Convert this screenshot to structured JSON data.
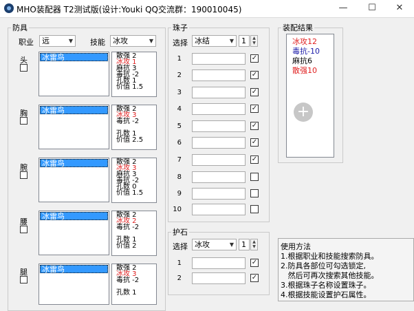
{
  "window": {
    "title": "MHO装配器 T2测试版(设计:Youki QQ交流群：190010045)",
    "minimize": "—",
    "maximize": "☐",
    "close": "✕"
  },
  "armor": {
    "group_label": "防具",
    "job_label": "职业",
    "job_value": "远",
    "skill_label": "技能",
    "skill_value": "冰攻",
    "slots": [
      {
        "name": "头",
        "item": "冰雷鸟",
        "stats": [
          {
            "t": "散强 2",
            "c": "normal"
          },
          {
            "t": "冰攻 1",
            "c": "red"
          },
          {
            "t": "麻抗 3",
            "c": "normal"
          },
          {
            "t": "毒抗 -2",
            "c": "normal"
          },
          {
            "t": "孔数 1",
            "c": "normal"
          },
          {
            "t": "价值 1.5",
            "c": "normal"
          }
        ]
      },
      {
        "name": "胸",
        "item": "冰雷鸟",
        "stats": [
          {
            "t": "散强 2",
            "c": "normal"
          },
          {
            "t": "冰攻 3",
            "c": "red"
          },
          {
            "t": "毒抗 -2",
            "c": "normal"
          },
          {
            "t": "",
            "c": "normal"
          },
          {
            "t": "孔数 1",
            "c": "normal"
          },
          {
            "t": "价值 2.5",
            "c": "normal"
          }
        ]
      },
      {
        "name": "腕",
        "item": "冰雷鸟",
        "stats": [
          {
            "t": "散强 2",
            "c": "normal"
          },
          {
            "t": "冰攻 3",
            "c": "red"
          },
          {
            "t": "麻抗 3",
            "c": "normal"
          },
          {
            "t": "毒抗 -2",
            "c": "normal"
          },
          {
            "t": "孔数 0",
            "c": "normal"
          },
          {
            "t": "价值 1.5",
            "c": "normal"
          }
        ]
      },
      {
        "name": "腰",
        "item": "冰雷鸟",
        "stats": [
          {
            "t": "散强 2",
            "c": "normal"
          },
          {
            "t": "冰攻 2",
            "c": "red"
          },
          {
            "t": "毒抗 -2",
            "c": "normal"
          },
          {
            "t": "",
            "c": "normal"
          },
          {
            "t": "孔数 1",
            "c": "normal"
          },
          {
            "t": "价值 2",
            "c": "normal"
          }
        ]
      },
      {
        "name": "腿",
        "item": "冰雷鸟",
        "stats": [
          {
            "t": "散强 2",
            "c": "normal"
          },
          {
            "t": "冰攻 3",
            "c": "red"
          },
          {
            "t": "毒抗 -2",
            "c": "normal"
          },
          {
            "t": "",
            "c": "normal"
          },
          {
            "t": "孔数 1",
            "c": "normal"
          }
        ]
      }
    ]
  },
  "beads": {
    "group_label": "珠子",
    "select_label": "选择",
    "select_value": "冰结",
    "count": "1",
    "rows": [
      {
        "n": "1",
        "checked": true
      },
      {
        "n": "2",
        "checked": true
      },
      {
        "n": "3",
        "checked": true
      },
      {
        "n": "4",
        "checked": true
      },
      {
        "n": "5",
        "checked": true
      },
      {
        "n": "6",
        "checked": true
      },
      {
        "n": "7",
        "checked": true
      },
      {
        "n": "8",
        "checked": false
      },
      {
        "n": "9",
        "checked": false
      },
      {
        "n": "10",
        "checked": false
      }
    ]
  },
  "amulet": {
    "group_label": "护石",
    "select_label": "选择",
    "select_value": "冰攻",
    "count": "1",
    "rows": [
      {
        "n": "1",
        "checked": true
      },
      {
        "n": "2",
        "checked": true
      }
    ]
  },
  "result": {
    "group_label": "装配结果",
    "lines": [
      {
        "t": "冰攻12",
        "c": "red"
      },
      {
        "t": "毒抗-10",
        "c": "blue"
      },
      {
        "t": "麻抗6",
        "c": "normal"
      },
      {
        "t": "散强10",
        "c": "red"
      }
    ],
    "add_icon": "plus-circle-icon"
  },
  "help": {
    "title": "使用方法",
    "lines": [
      "1.根据职业和技能搜索防具。",
      "2.防具各部位可勾选锁定,",
      "   然后可再次搜索其他技能。",
      "3.根据珠子名称设置珠子。",
      "4.根据技能设置护石属性。"
    ]
  },
  "colors": {
    "red": "#e02020",
    "blue": "#1a1aa8",
    "selection": "#3399ff"
  }
}
